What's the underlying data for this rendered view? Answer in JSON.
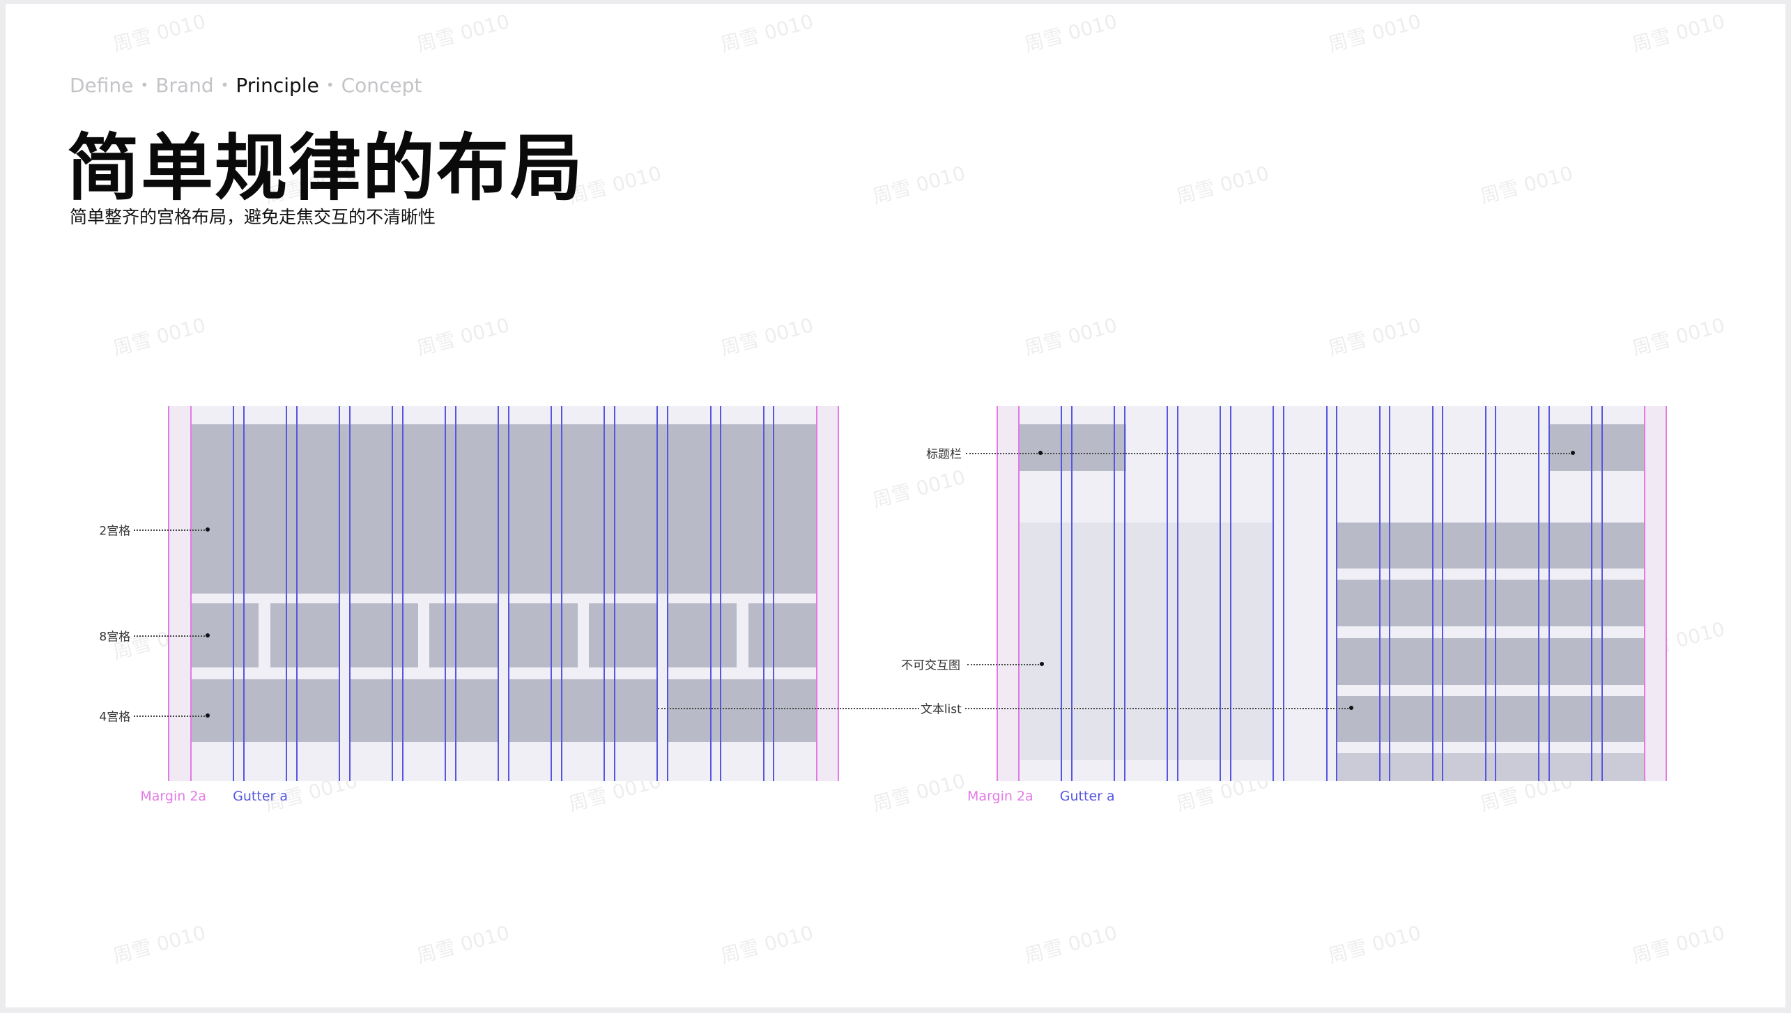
{
  "breadcrumb": {
    "items": [
      {
        "label": "Define",
        "active": false
      },
      {
        "label": "Brand",
        "active": false
      },
      {
        "label": "Principle",
        "active": true
      },
      {
        "label": "Concept",
        "active": false
      }
    ],
    "separator": "•"
  },
  "title": "简单规律的布局",
  "subtitle": "简单整齐的宫格布局，避免走焦交互的不清晰性",
  "watermark": "周雪 0010",
  "colors": {
    "margin_line": "#e27ae6",
    "gutter_line": "#5656e0",
    "grid_bg": "#efeff5",
    "block": "#b9bac7",
    "block_light": "#e3e3ec",
    "block_mid": "#cacbd6"
  },
  "diagram_left": {
    "labels": {
      "two_grid": "2宫格",
      "eight_grid": "8宫格",
      "four_grid": "4宫格"
    },
    "legend": {
      "margin": "Margin 2a",
      "gutter": "Gutter a"
    }
  },
  "diagram_right": {
    "labels": {
      "title_bar": "标题栏",
      "non_interactive": "不可交互图",
      "text_list": "文本list"
    },
    "legend": {
      "margin": "Margin 2a",
      "gutter": "Gutter a"
    }
  }
}
